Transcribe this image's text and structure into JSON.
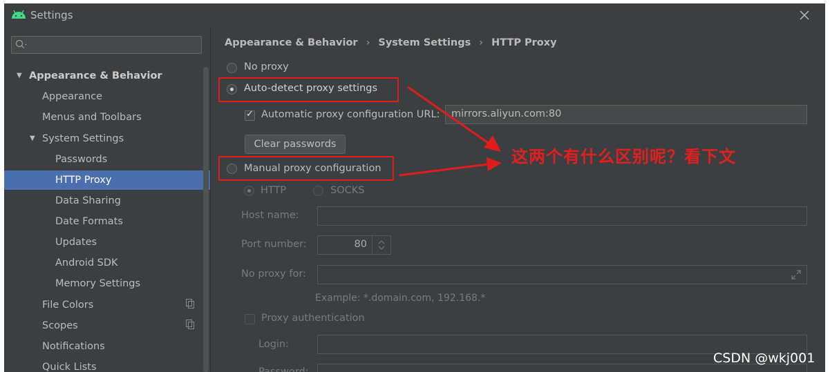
{
  "window": {
    "title": "Settings"
  },
  "sidebar": {
    "items": [
      {
        "label": "Appearance & Behavior"
      },
      {
        "label": "Appearance"
      },
      {
        "label": "Menus and Toolbars"
      },
      {
        "label": "System Settings"
      },
      {
        "label": "Passwords"
      },
      {
        "label": "HTTP Proxy"
      },
      {
        "label": "Data Sharing"
      },
      {
        "label": "Date Formats"
      },
      {
        "label": "Updates"
      },
      {
        "label": "Android SDK"
      },
      {
        "label": "Memory Settings"
      },
      {
        "label": "File Colors"
      },
      {
        "label": "Scopes"
      },
      {
        "label": "Notifications"
      },
      {
        "label": "Quick Lists"
      }
    ]
  },
  "breadcrumb": [
    "Appearance & Behavior",
    "System Settings",
    "HTTP Proxy"
  ],
  "proxy": {
    "no_proxy": "No proxy",
    "auto_detect": "Auto-detect proxy settings",
    "auto_url_label": "Automatic proxy configuration URL:",
    "auto_url_value": "mirrors.aliyun.com:80",
    "clear_passwords": "Clear passwords",
    "manual": "Manual proxy configuration",
    "http": "HTTP",
    "socks": "SOCKS",
    "host_label": "Host name:",
    "port_label": "Port number:",
    "port_value": "80",
    "no_proxy_for_label": "No proxy for:",
    "example": "Example: *.domain.com, 192.168.*",
    "proxy_auth": "Proxy authentication",
    "login_label": "Login:",
    "password_label": "Password:"
  },
  "annotation": "这两个有什么区别呢？看下文",
  "watermark": "CSDN @wkj001",
  "colors": {
    "accent": "#4b6eaf",
    "annotation_red": "#e21b1b",
    "background": "#3c3f41"
  }
}
